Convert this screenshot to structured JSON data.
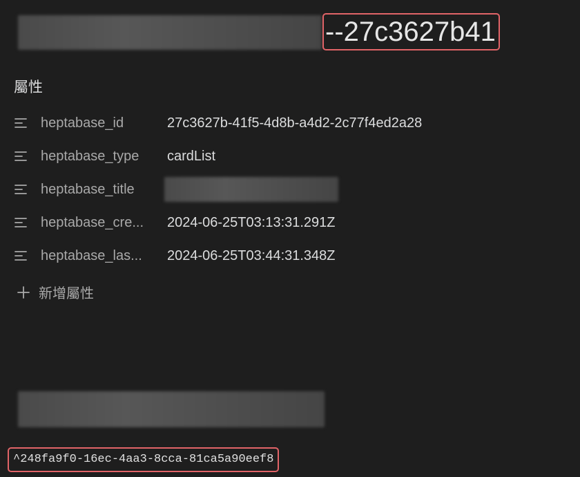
{
  "note": {
    "title_suffix": "--27c3627b41",
    "properties_heading": "屬性",
    "properties": [
      {
        "key": "heptabase_id",
        "value": "27c3627b-41f5-4d8b-a4d2-2c77f4ed2a28"
      },
      {
        "key": "heptabase_type",
        "value": "cardList"
      },
      {
        "key": "heptabase_title",
        "value": ""
      },
      {
        "key": "heptabase_cre...",
        "value": "2024-06-25T03:13:31.291Z"
      },
      {
        "key": "heptabase_las...",
        "value": "2024-06-25T03:44:31.348Z"
      }
    ],
    "add_property_label": "新增屬性",
    "block_id": "^248fa9f0-16ec-4aa3-8cca-81ca5a90eef8"
  },
  "icons": {
    "property_type": "text-lines-icon",
    "add": "plus-icon"
  },
  "colors": {
    "background": "#1e1e1e",
    "highlight_border": "#e26468",
    "muted_text": "#a9a9a9",
    "text": "#dcddde"
  }
}
